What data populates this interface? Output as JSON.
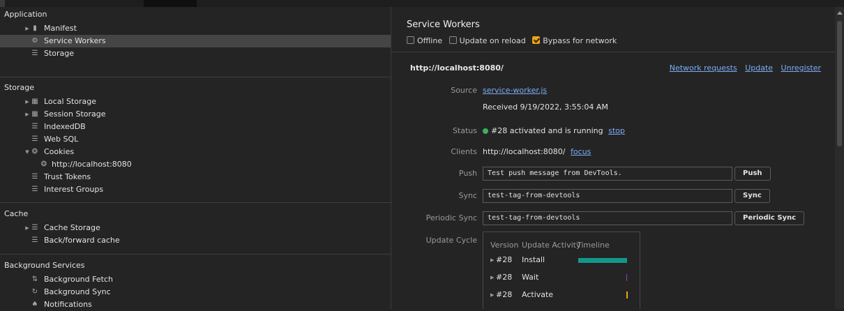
{
  "sidebar": {
    "application": {
      "title": "Application",
      "items": [
        {
          "label": "Manifest"
        },
        {
          "label": "Service Workers"
        },
        {
          "label": "Storage"
        }
      ]
    },
    "storage": {
      "title": "Storage",
      "items": [
        {
          "label": "Local Storage"
        },
        {
          "label": "Session Storage"
        },
        {
          "label": "IndexedDB"
        },
        {
          "label": "Web SQL"
        },
        {
          "label": "Cookies"
        },
        {
          "label": "http://localhost:8080"
        },
        {
          "label": "Trust Tokens"
        },
        {
          "label": "Interest Groups"
        }
      ]
    },
    "cache": {
      "title": "Cache",
      "items": [
        {
          "label": "Cache Storage"
        },
        {
          "label": "Back/forward cache"
        }
      ]
    },
    "background": {
      "title": "Background Services",
      "items": [
        {
          "label": "Background Fetch"
        },
        {
          "label": "Background Sync"
        },
        {
          "label": "Notifications"
        }
      ]
    }
  },
  "main": {
    "title": "Service Workers",
    "options": {
      "offline": {
        "label": "Offline",
        "checked": false
      },
      "update_on_reload": {
        "label": "Update on reload",
        "checked": false
      },
      "bypass": {
        "label": "Bypass for network",
        "checked": true
      }
    },
    "origin": "http://localhost:8080/",
    "links": {
      "network_requests": "Network requests",
      "update": "Update",
      "unregister": "Unregister"
    },
    "source": {
      "label": "Source",
      "file": "service-worker.js",
      "received": "Received 9/19/2022, 3:55:04 AM"
    },
    "status": {
      "label": "Status",
      "text": "#28 activated and is running",
      "stop": "stop",
      "color": "#3bb35c"
    },
    "clients": {
      "label": "Clients",
      "value": "http://localhost:8080/",
      "focus": "focus"
    },
    "push": {
      "label": "Push",
      "value": "Test push message from DevTools.",
      "button": "Push"
    },
    "sync": {
      "label": "Sync",
      "value": "test-tag-from-devtools",
      "button": "Sync"
    },
    "periodic_sync": {
      "label": "Periodic Sync",
      "value": "test-tag-from-devtools",
      "button": "Periodic Sync"
    },
    "update_cycle": {
      "label": "Update Cycle",
      "headers": {
        "version": "Version",
        "activity": "Update Activity",
        "timeline": "Timeline"
      },
      "rows": [
        {
          "version": "#28",
          "activity": "Install",
          "color": "#12978a"
        },
        {
          "version": "#28",
          "activity": "Wait",
          "color": "#8e44c9"
        },
        {
          "version": "#28",
          "activity": "Activate",
          "color": "#f0a30a"
        }
      ]
    }
  },
  "colors": {
    "accent": "#f0a30a",
    "link": "#7cacf8",
    "background": "#242424"
  }
}
